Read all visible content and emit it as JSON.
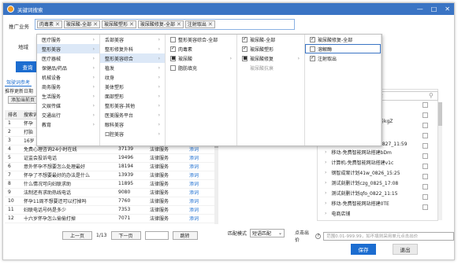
{
  "window": {
    "title": "关键词搜索",
    "controls": [
      "—",
      "□",
      "✕"
    ]
  },
  "promo": {
    "label": "推广业务"
  },
  "tags": [
    "肉毒素",
    "玻尿酸-全部",
    "玻尿酸塑形",
    "玻尿酸修复-全部",
    "注射取出"
  ],
  "region": {
    "label": "地域"
  },
  "query_label": "查询",
  "subtabs": [
    "驾驶词参考"
  ],
  "blurb": "推荐更新日期",
  "add_label": "添加当前页",
  "table": {
    "headers": [
      "排名",
      "搜索词",
      "",
      "",
      ""
    ],
    "rows": [
      [
        "1",
        "怀孕",
        "",
        "",
        ""
      ],
      [
        "2",
        "打胎",
        "",
        "",
        ""
      ],
      [
        "3",
        "16岁",
        "",
        "",
        ""
      ],
      [
        "4",
        "免费心理咨询24小时在线",
        "37139",
        "法律服务",
        "添词"
      ],
      [
        "5",
        "证监会投诉电话",
        "19496",
        "法律服务",
        "添词"
      ],
      [
        "6",
        "意外怀孕不想要怎么处理最好",
        "18194",
        "法律服务",
        "添词"
      ],
      [
        "7",
        "怀孕了不想要最好的办法是什么",
        "13939",
        "法律服务",
        "添词"
      ],
      [
        "8",
        "什么情况可向妇联求助",
        "11895",
        "法律服务",
        "添词"
      ],
      [
        "9",
        "法制还有求助热线电话",
        "9080",
        "法律服务",
        "添词"
      ],
      [
        "10",
        "怀孕11周不想要还可以打掉吗",
        "7760",
        "法律服务",
        "添词"
      ],
      [
        "11",
        "妇联电话号码是多少",
        "7353",
        "法律服务",
        "添词"
      ],
      [
        "12",
        "十六岁怀孕怎么偷偷打掉",
        "7071",
        "法律服务",
        "添词"
      ]
    ]
  },
  "pager": {
    "prev": "上一页",
    "page": "1/13",
    "next": "下一页",
    "jump": "跳转"
  },
  "dropdown": {
    "col1": [
      "医疗服务",
      "整形美容",
      "医疗器械",
      "保健品/药品",
      "机械设备",
      "商务服务",
      "生活服务",
      "文娱传媒",
      "交通出行",
      "教育"
    ],
    "col2": [
      "舌部美容",
      "整形修复外科",
      "整形美容综合",
      "植发",
      "纹身",
      "美体塑形",
      "面部塑形",
      "整形美容-其他",
      "医美服务平台",
      "眼科美容",
      "口腔美容"
    ],
    "col3": [
      {
        "t": "整形美容综合-全部",
        "s": ""
      },
      {
        "t": "肉毒素",
        "s": "on"
      },
      {
        "t": "玻尿酸",
        "s": "part"
      },
      {
        "t": "脂肪填充",
        "s": ""
      }
    ],
    "col4": [
      {
        "t": "玻尿酸-全部",
        "s": "on"
      },
      {
        "t": "玻尿酸塑形",
        "s": "on"
      },
      {
        "t": "玻尿酸修复",
        "s": "part"
      },
      {
        "t": "玻尿酸抗衰",
        "s": "dim"
      }
    ],
    "col5": [
      {
        "t": "玻尿酸修复-全部",
        "s": "on"
      },
      {
        "t": "溶解酶",
        "s": ""
      },
      {
        "t": "注射取出",
        "s": "on"
      }
    ]
  },
  "right": {
    "search_ph": "搜索",
    "rows": [
      "移动-免费智能网站搭建bDm",
      "计算机-免费智能网站搭建v1c",
      "钢智成案计划41w_0826_15:25",
      "测试刻删计划czg_0825_17:08",
      "测试刻删计划qfo_0822_11:15",
      "移动-免费智能网站搭建0TE",
      "电商店铺"
    ],
    "mid1": "务kgZ",
    "mid2": "0827_11:59"
  },
  "match": {
    "label": "匹配模式",
    "value": "短语匹配"
  },
  "bid": {
    "label": "点击出价",
    "placeholder": "范围0.01-999.99，如不填则采用单元点击出价"
  },
  "save_label": "保存",
  "exit_label": "退出"
}
